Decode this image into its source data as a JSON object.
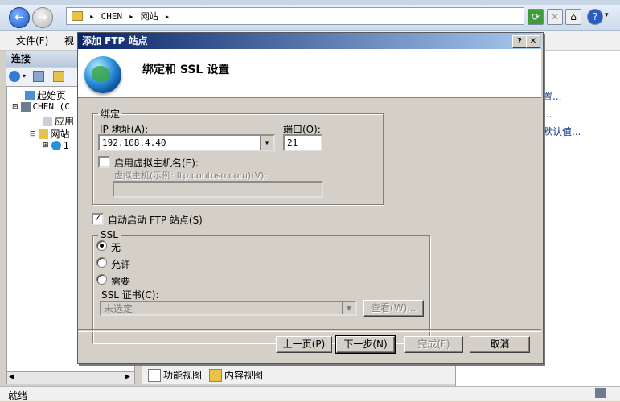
{
  "address_bar": {
    "path": [
      "CHEN",
      "网站"
    ]
  },
  "menu": {
    "file": "文件(F)",
    "view": "视"
  },
  "connections": {
    "header": "连接",
    "tree": [
      {
        "label": "起始页"
      },
      {
        "label": "CHEN (C"
      },
      {
        "label": "应用"
      },
      {
        "label": "网站"
      },
      {
        "label": "1"
      }
    ]
  },
  "right_pane": {
    "links": [
      "置...",
      "...",
      "默认值..."
    ]
  },
  "view_tabs": {
    "features": "功能视图",
    "content": "内容视图"
  },
  "status": {
    "text": "就绪"
  },
  "dialog": {
    "title": "添加 FTP 站点",
    "heading": "绑定和 SSL 设置",
    "binding": {
      "legend": "绑定",
      "ip_label": "IP 地址(A):",
      "ip_value": "192.168.4.40",
      "port_label": "端口(O):",
      "port_value": "21",
      "vhost_label": "启用虚拟主机名(E):",
      "vhost_checked": false,
      "vhost_sub_label": "虚拟主机(示例: ftp.contoso.com)(V):",
      "vhost_value": ""
    },
    "autostart": {
      "label": "自动启动 FTP 站点(S)",
      "checked": true
    },
    "ssl": {
      "legend": "SSL",
      "options": [
        "无",
        "允许",
        "需要"
      ],
      "selected": "无",
      "cert_label": "SSL 证书(C):",
      "cert_value": "未选定",
      "view_button": "查看(W)..."
    },
    "buttons": {
      "prev": "上一页(P)",
      "next": "下一步(N)",
      "finish": "完成(F)",
      "cancel": "取消"
    },
    "caption": {
      "help": "?",
      "close": "✕"
    }
  }
}
